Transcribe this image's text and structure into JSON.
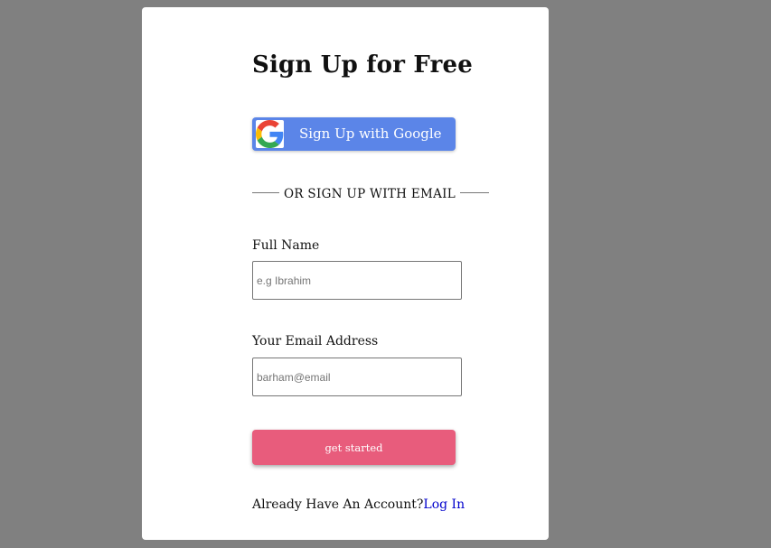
{
  "form": {
    "title": "Sign Up for Free",
    "google_button_label": "Sign Up with Google",
    "divider_text": "OR SIGN UP WITH EMAIL",
    "full_name": {
      "label": "Full Name",
      "placeholder": "e.g Ibrahim",
      "value": ""
    },
    "email": {
      "label": "Your Email Address",
      "placeholder": "barham@email",
      "value": ""
    },
    "submit_label": "get started",
    "footer_text": "Already Have An Account?",
    "login_link": "Log In"
  },
  "colors": {
    "backdrop": "#808080",
    "card": "#ffffff",
    "google_button": "#5b85e8",
    "cta_button": "#e85c7c",
    "link": "#0000cc"
  },
  "icons": {
    "google": "google-g-logo-icon"
  }
}
